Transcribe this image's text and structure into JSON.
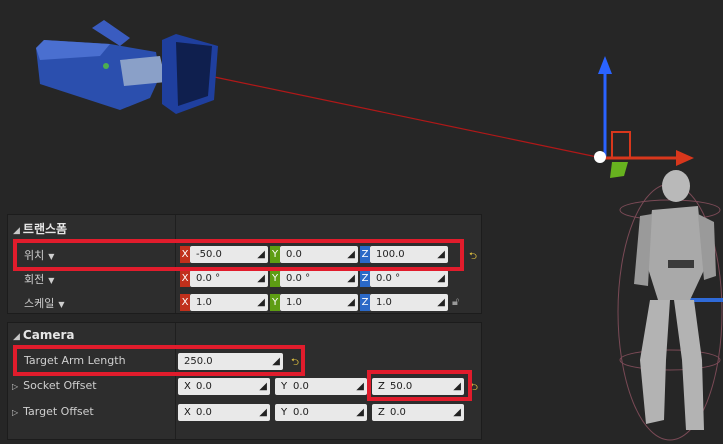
{
  "colors": {
    "background": "#262626",
    "panel": "#2d2d2d",
    "axis_x": "#c1301c",
    "axis_y": "#5e9d13",
    "axis_z": "#2b69c7",
    "highlight": "#e11c2c",
    "field": "#e9e9e9"
  },
  "viewport": {
    "objects": [
      "camera-actor",
      "transform-gizmo",
      "mannequin-character",
      "spring-arm-line"
    ]
  },
  "transform": {
    "title": "트랜스폼",
    "location": {
      "label": "위치",
      "x": "-50.0",
      "y": "0.0",
      "z": "100.0"
    },
    "rotation": {
      "label": "회전",
      "x": "0.0 °",
      "y": "0.0 °",
      "z": "0.0 °"
    },
    "scale": {
      "label": "스케일",
      "x": "1.0",
      "y": "1.0",
      "z": "1.0"
    }
  },
  "camera": {
    "title": "Camera",
    "target_arm_length": {
      "label": "Target Arm Length",
      "value": "250.0"
    },
    "socket_offset": {
      "label": "Socket Offset",
      "x": "0.0",
      "y": "0.0",
      "z": "50.0"
    },
    "target_offset": {
      "label": "Target Offset",
      "x": "0.0",
      "y": "0.0",
      "z": "0.0"
    }
  },
  "axis_letters": {
    "x": "X",
    "y": "Y",
    "z": "Z"
  }
}
